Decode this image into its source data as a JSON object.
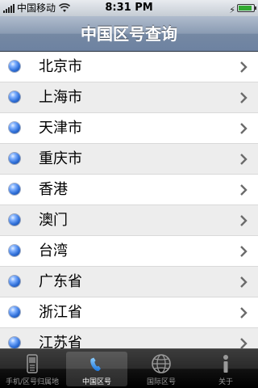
{
  "status_bar": {
    "carrier": "中国移动",
    "time": "8:31 PM"
  },
  "navbar": {
    "title": "中国区号查询"
  },
  "list": {
    "items": [
      {
        "label": "北京市"
      },
      {
        "label": "上海市"
      },
      {
        "label": "天津市"
      },
      {
        "label": "重庆市"
      },
      {
        "label": "香港"
      },
      {
        "label": "澳门"
      },
      {
        "label": "台湾"
      },
      {
        "label": "广东省"
      },
      {
        "label": "浙江省"
      },
      {
        "label": "江苏省"
      }
    ]
  },
  "tabbar": {
    "tabs": [
      {
        "label": "手机/区号归属地",
        "icon": "phone-icon",
        "selected": false
      },
      {
        "label": "中国区号",
        "icon": "handset-icon",
        "selected": true
      },
      {
        "label": "国际区号",
        "icon": "globe-icon",
        "selected": false
      },
      {
        "label": "关于",
        "icon": "info-icon",
        "selected": false
      }
    ]
  },
  "colors": {
    "navbar": "#7588a3",
    "row_alt": "#ededed",
    "selected_tab_icon": "#4aa3ff"
  }
}
